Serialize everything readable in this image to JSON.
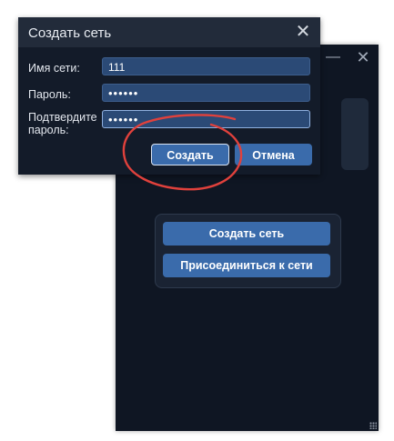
{
  "main_window": {
    "minimize_glyph": "—",
    "close_glyph": "✕",
    "create_network_label": "Создать сеть",
    "join_network_label": "Присоединиться к сети"
  },
  "dialog": {
    "title": "Создать сеть",
    "close_glyph": "✕",
    "network_name_label": "Имя сети:",
    "network_name_value": "111",
    "password_label": "Пароль:",
    "password_value": "••••••",
    "confirm_label_line1": "Подтвердите",
    "confirm_label_line2": "пароль:",
    "confirm_value": "••••••",
    "create_label": "Создать",
    "cancel_label": "Отмена"
  },
  "colors": {
    "window_bg": "#0f1623",
    "dialog_bg": "#131b29",
    "button_blue": "#3a6bab",
    "input_blue": "#2b4a76",
    "annotation_red": "#e0413c"
  },
  "icons": {
    "minimize": "minimize-icon",
    "close": "close-icon",
    "resize": "resize-grip-icon"
  }
}
